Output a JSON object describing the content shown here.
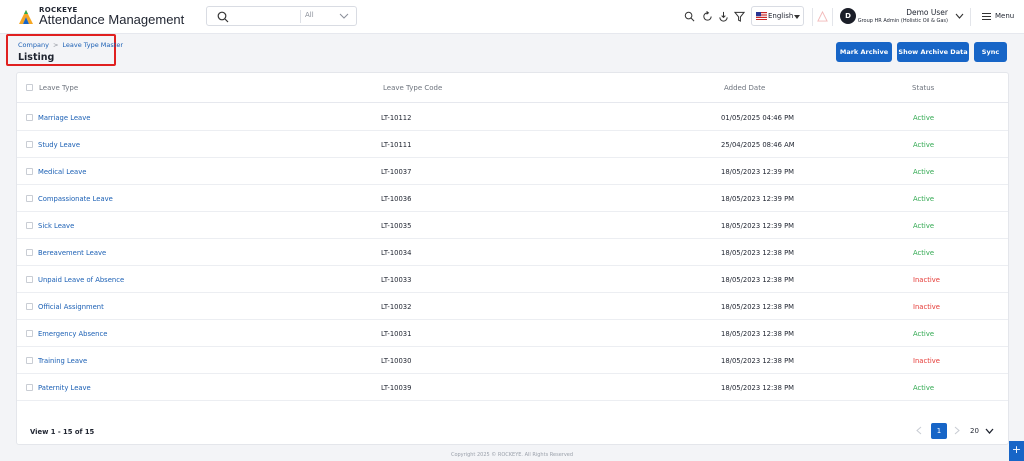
{
  "header": {
    "brand_small": "ROCKEYE",
    "brand_title": "Attendance Management",
    "search": {
      "placeholder": "",
      "scope": "All"
    },
    "language": "English",
    "user": {
      "initial": "D",
      "name": "Demo User",
      "role": "Group HR Admin (Holistic Oil & Gas)"
    },
    "menu_label": "Menu",
    "icons": [
      "search-icon",
      "refresh-icon",
      "download-icon",
      "filter-icon",
      "alert-icon"
    ]
  },
  "page": {
    "breadcrumb": [
      "Company",
      "Leave Type Master"
    ],
    "title": "Listing",
    "buttons": {
      "mark_archive": "Mark Archive",
      "show_archive": "Show Archive Data",
      "sync": "Sync"
    }
  },
  "table": {
    "columns": [
      "Leave Type",
      "Leave Type Code",
      "Added Date",
      "Status"
    ],
    "rows": [
      {
        "name": "Marriage Leave",
        "code": "LT-10112",
        "date": "01/05/2025 04:46 PM",
        "status": "Active"
      },
      {
        "name": "Study Leave",
        "code": "LT-10111",
        "date": "25/04/2025 08:46 AM",
        "status": "Active"
      },
      {
        "name": "Medical Leave",
        "code": "LT-10037",
        "date": "18/05/2023 12:39 PM",
        "status": "Active"
      },
      {
        "name": "Compassionate Leave",
        "code": "LT-10036",
        "date": "18/05/2023 12:39 PM",
        "status": "Active"
      },
      {
        "name": "Sick Leave",
        "code": "LT-10035",
        "date": "18/05/2023 12:39 PM",
        "status": "Active"
      },
      {
        "name": "Bereavement Leave",
        "code": "LT-10034",
        "date": "18/05/2023 12:38 PM",
        "status": "Active"
      },
      {
        "name": "Unpaid Leave of Absence",
        "code": "LT-10033",
        "date": "18/05/2023 12:38 PM",
        "status": "Inactive"
      },
      {
        "name": "Official Assignment",
        "code": "LT-10032",
        "date": "18/05/2023 12:38 PM",
        "status": "Inactive"
      },
      {
        "name": "Emergency Absence",
        "code": "LT-10031",
        "date": "18/05/2023 12:38 PM",
        "status": "Active"
      },
      {
        "name": "Training Leave",
        "code": "LT-10030",
        "date": "18/05/2023 12:38 PM",
        "status": "Inactive"
      },
      {
        "name": "Paternity Leave",
        "code": "LT-10039",
        "date": "18/05/2023 12:38 PM",
        "status": "Active"
      }
    ],
    "status_colors": {
      "Active": "#2fa84f",
      "Inactive": "#e53935"
    }
  },
  "pagination": {
    "view_info": "View 1 - 15 of 15",
    "current_page": "1",
    "page_size": "20"
  },
  "footer": {
    "copyright": "Copyright 2025 © ROCKEYE. All Rights Reserved"
  },
  "colors": {
    "primary": "#1765c7",
    "highlight": "#e02020",
    "link": "#1a5fb4"
  }
}
